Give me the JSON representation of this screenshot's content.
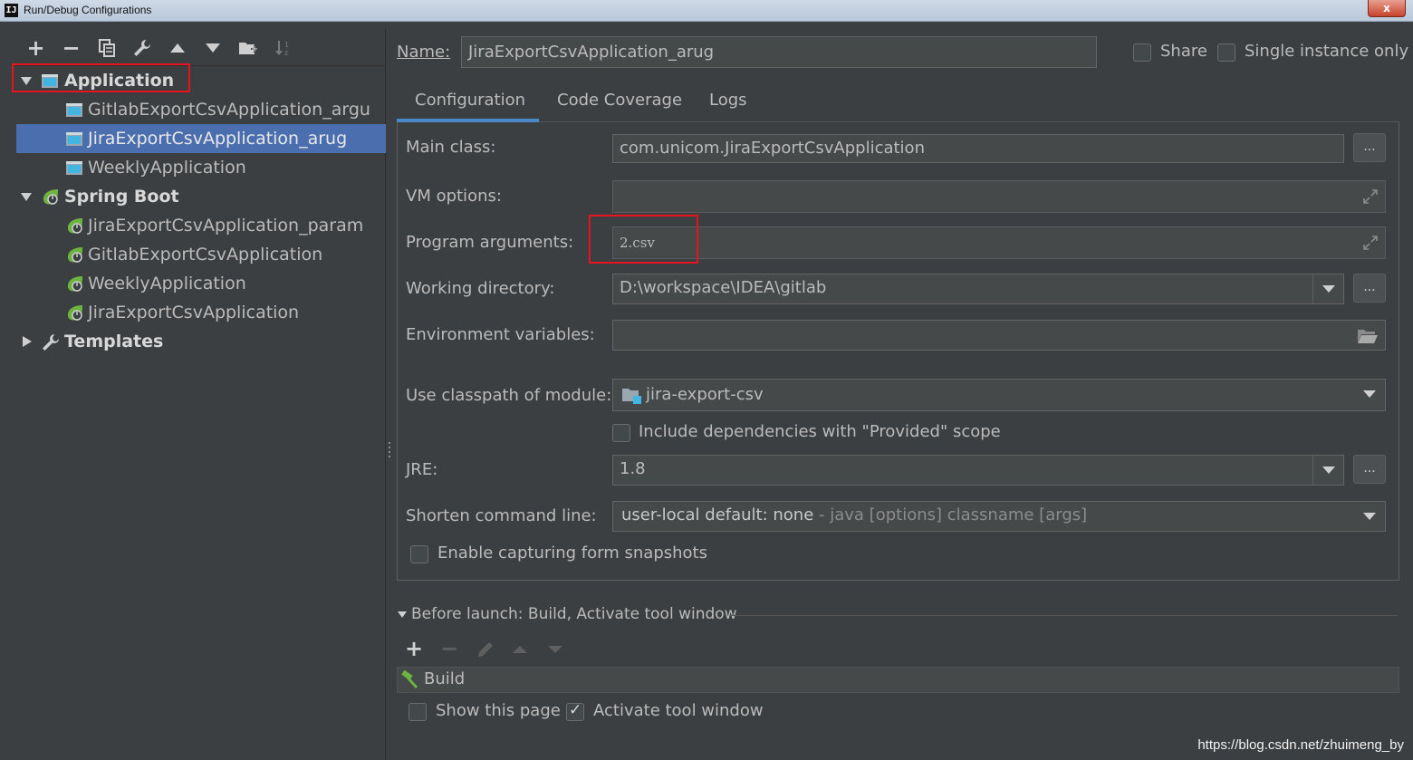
{
  "window": {
    "title": "Run/Debug Configurations",
    "app_icon_glyph": "IJ",
    "close_glyph": "x"
  },
  "toolbar": {
    "icons": [
      "add-icon",
      "remove-icon",
      "copy-icon",
      "wrench-icon",
      "move-up-icon",
      "move-down-icon",
      "new-folder-icon",
      "sort-alpha-icon"
    ],
    "add_glyph": "+",
    "remove_glyph": "−"
  },
  "tree": {
    "application": {
      "label": "Application",
      "children": [
        "GitlabExportCsvApplication_argu",
        "JiraExportCsvApplication_arug",
        "WeeklyApplication"
      ]
    },
    "spring_boot": {
      "label": "Spring Boot",
      "children": [
        "JiraExportCsvApplication_param",
        "GitlabExportCsvApplication",
        "WeeklyApplication",
        "JiraExportCsvApplication"
      ]
    },
    "templates": {
      "label": "Templates"
    },
    "selected": "JiraExportCsvApplication_arug"
  },
  "header": {
    "name_label": "Name:",
    "name_value": "JiraExportCsvApplication_arug",
    "share_label": "Share",
    "single_instance_label": "Single instance only",
    "share_checked": false,
    "single_instance_checked": false
  },
  "tabs": [
    "Configuration",
    "Code Coverage",
    "Logs"
  ],
  "active_tab": "Configuration",
  "config": {
    "main_class_label": "Main class:",
    "main_class_value": "com.unicom.JiraExportCsvApplication",
    "vm_options_label": "VM options:",
    "vm_options_value": "",
    "program_args_label": "Program arguments:",
    "program_args_value": "2.csv",
    "working_dir_label": "Working directory:",
    "working_dir_value": "D:\\workspace\\IDEA\\gitlab",
    "env_vars_label": "Environment variables:",
    "env_vars_value": "",
    "classpath_label": "Use classpath of module:",
    "classpath_value": "jira-export-csv",
    "include_deps_label": "Include dependencies with \"Provided\" scope",
    "include_deps_checked": false,
    "jre_label": "JRE:",
    "jre_value": "1.8",
    "shorten_label": "Shorten command line:",
    "shorten_value": "user-local default: none",
    "shorten_hint": " - java [options] classname [args]",
    "snapshots_label": "Enable capturing form snapshots",
    "snapshots_checked": false,
    "browse_label": "..."
  },
  "before_launch": {
    "title": "Before launch: Build, Activate tool window",
    "tasks": [
      "Build"
    ],
    "show_page_label": "Show this page",
    "show_page_checked": false,
    "activate_label": "Activate tool window",
    "activate_checked": true
  },
  "watermark": "https://blog.csdn.net/zhuimeng_by",
  "colors": {
    "background": "#3c3f41",
    "selection": "#4b6eaf",
    "highlight_box": "#e8141d",
    "tab_underline": "#4a88c7",
    "spring_green": "#6db33f"
  }
}
